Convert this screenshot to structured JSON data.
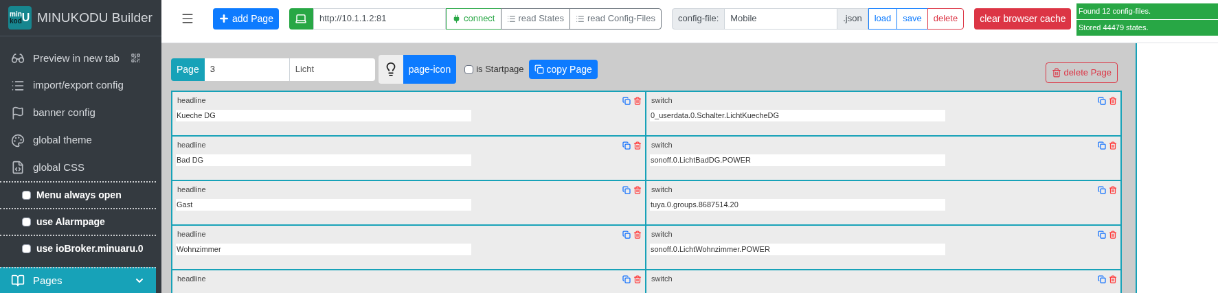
{
  "sidebar": {
    "title": "MINUKODU Builder",
    "logo": {
      "line_1": "min",
      "line_2": "kod",
      "line_3": "U"
    },
    "items": [
      {
        "kind": "link",
        "label": "Preview in new tab"
      },
      {
        "kind": "link",
        "label": "import/export config"
      },
      {
        "kind": "link",
        "label": "banner config"
      },
      {
        "kind": "link",
        "label": "global theme"
      },
      {
        "kind": "link",
        "label": "global CSS"
      },
      {
        "kind": "checkbox",
        "label": "Menu always open",
        "checked": false
      },
      {
        "kind": "checkbox",
        "label": "use Alarmpage",
        "checked": false
      },
      {
        "kind": "checkbox",
        "label": "use ioBroker.minuaru.0",
        "checked": false
      },
      {
        "kind": "section",
        "label": "Pages",
        "expanded": true
      }
    ]
  },
  "toolbar": {
    "add_page": "add Page",
    "url": "http://10.1.1.2:81",
    "connect": "connect",
    "read_states": "read States",
    "read_config": "read Config-Files",
    "config_label": "config-file:",
    "config_value": "Mobile",
    "config_ext": ".json",
    "load": "load",
    "save": "save",
    "delete": "delete",
    "clear_cache": "clear browser cache"
  },
  "alerts": [
    "Found 12 config-files.",
    "Stored 44479 states."
  ],
  "page": {
    "label": "Page",
    "number": "3",
    "name": "Licht",
    "icon_button": "page-icon",
    "is_startpage": {
      "label": "is Startpage",
      "checked": false
    },
    "copy": "copy Page",
    "delete": "delete Page"
  },
  "rows": [
    {
      "left": {
        "type": "headline",
        "value": "Kueche DG"
      },
      "right": {
        "type": "switch",
        "value": "0_userdata.0.Schalter.LichtKuecheDG"
      }
    },
    {
      "left": {
        "type": "headline",
        "value": "Bad DG"
      },
      "right": {
        "type": "switch",
        "value": "sonoff.0.LichtBadDG.POWER"
      }
    },
    {
      "left": {
        "type": "headline",
        "value": "Gast"
      },
      "right": {
        "type": "switch",
        "value": "tuya.0.groups.8687514.20"
      }
    },
    {
      "left": {
        "type": "headline",
        "value": "Wohnzimmer"
      },
      "right": {
        "type": "switch",
        "value": "sonoff.0.LichtWohnzimmer.POWER"
      }
    },
    {
      "left": {
        "type": "headline"
      },
      "right": {
        "type": "switch"
      }
    }
  ]
}
